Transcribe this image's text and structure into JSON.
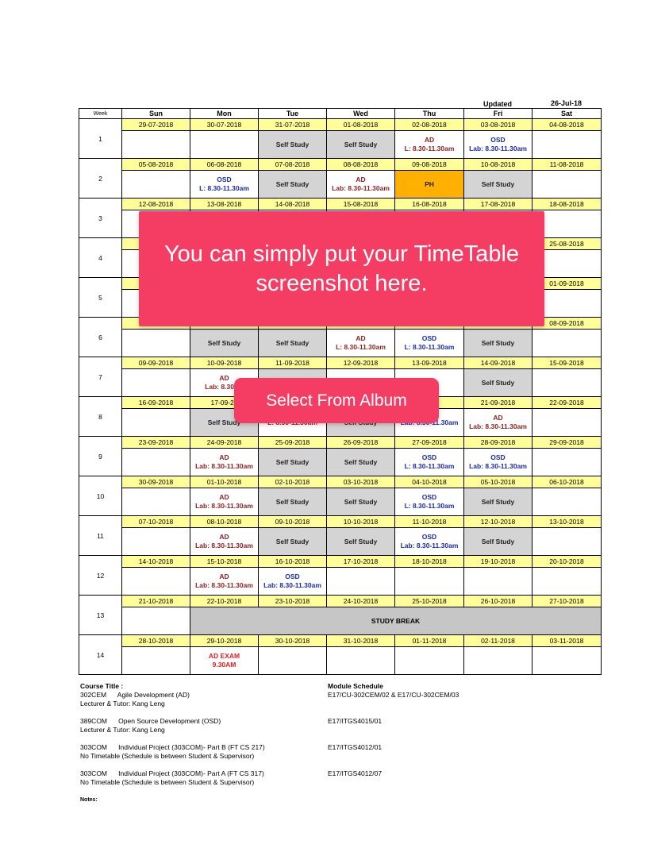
{
  "header": {
    "updated_label": "Updated",
    "updated_date": "26-Jul-18"
  },
  "days": [
    "Week",
    "Sun",
    "Mon",
    "Tue",
    "Wed",
    "Thu",
    "Fri",
    "Sat"
  ],
  "weeks": [
    {
      "week": "1",
      "dates": [
        "29-07-2018",
        "30-07-2018",
        "31-07-2018",
        "01-08-2018",
        "02-08-2018",
        "03-08-2018",
        "04-08-2018"
      ],
      "cells": [
        null,
        null,
        {
          "type": "ss",
          "lines": [
            "Self Study"
          ]
        },
        {
          "type": "ss",
          "lines": [
            "Self Study"
          ]
        },
        {
          "type": "ad",
          "lines": [
            "AD",
            "L: 8.30-11.30am"
          ]
        },
        {
          "type": "osd",
          "lines": [
            "OSD",
            "Lab: 8.30-11.30am"
          ]
        },
        null
      ]
    },
    {
      "week": "2",
      "dates": [
        "05-08-2018",
        "06-08-2018",
        "07-08-2018",
        "08-08-2018",
        "09-08-2018",
        "10-08-2018",
        "11-08-2018"
      ],
      "cells": [
        null,
        {
          "type": "osd",
          "lines": [
            "OSD",
            "L: 8.30-11.30am"
          ]
        },
        {
          "type": "ss",
          "lines": [
            "Self Study"
          ]
        },
        {
          "type": "ad",
          "lines": [
            "AD",
            "Lab: 8.30-11.30am"
          ]
        },
        {
          "type": "ph",
          "lines": [
            "PH"
          ]
        },
        {
          "type": "ss",
          "lines": [
            "Self Study"
          ]
        },
        null
      ]
    },
    {
      "week": "3",
      "dates": [
        "12-08-2018",
        "13-08-2018",
        "14-08-2018",
        "15-08-2018",
        "16-08-2018",
        "17-08-2018",
        "18-08-2018"
      ],
      "cells": [
        null,
        null,
        null,
        null,
        null,
        null,
        null
      ]
    },
    {
      "week": "4",
      "dates": [
        "",
        "",
        "",
        "",
        "",
        "",
        "25-08-2018"
      ],
      "cells": [
        null,
        null,
        null,
        null,
        null,
        null,
        null
      ]
    },
    {
      "week": "5",
      "dates": [
        "",
        "",
        "",
        "",
        "",
        "",
        "01-09-2018"
      ],
      "cells": [
        null,
        null,
        null,
        null,
        null,
        null,
        null
      ]
    },
    {
      "week": "6",
      "dates": [
        "",
        "",
        "",
        "",
        "",
        "",
        "08-09-2018"
      ],
      "cells": [
        null,
        {
          "type": "ss",
          "lines": [
            "Self Study"
          ]
        },
        {
          "type": "ss",
          "lines": [
            "Self Study"
          ]
        },
        {
          "type": "ad",
          "lines": [
            "AD",
            "L: 8.30-11.30am"
          ]
        },
        {
          "type": "osd",
          "lines": [
            "OSD",
            "L: 8.30-11.30am"
          ]
        },
        {
          "type": "ss",
          "lines": [
            "Self Study"
          ]
        },
        null
      ]
    },
    {
      "week": "7",
      "dates": [
        "09-09-2018",
        "10-09-2018",
        "11-09-2018",
        "12-09-2018",
        "13-09-2018",
        "14-09-2018",
        "15-09-2018"
      ],
      "cells": [
        null,
        {
          "type": "ad",
          "lines": [
            "AD",
            "Lab: 8.30-11"
          ]
        },
        {
          "type": "ss",
          "lines": [
            ""
          ]
        },
        null,
        {
          "type": "osd",
          "lines": [
            "",
            ".30am"
          ]
        },
        {
          "type": "ss",
          "lines": [
            "Self Study"
          ]
        },
        null
      ]
    },
    {
      "week": "8",
      "dates": [
        "16-09-2018",
        "17-09-20",
        "",
        "",
        "18",
        "21-09-2018",
        "22-09-2018"
      ],
      "cells": [
        null,
        {
          "type": "ss",
          "lines": [
            "Self Study"
          ]
        },
        {
          "type": "ad",
          "lines": [
            "",
            "L: 8.30-11.30am"
          ]
        },
        {
          "type": "ss",
          "lines": [
            "Self Study"
          ]
        },
        {
          "type": "osd",
          "lines": [
            "",
            "Lab: 8.30-11.30am"
          ]
        },
        {
          "type": "ad",
          "lines": [
            "AD",
            "Lab: 8.30-11.30am"
          ]
        },
        null
      ]
    },
    {
      "week": "9",
      "dates": [
        "23-09-2018",
        "24-09-2018",
        "25-09-2018",
        "26-09-2018",
        "27-09-2018",
        "28-09-2018",
        "29-09-2018"
      ],
      "cells": [
        null,
        {
          "type": "ad",
          "lines": [
            "AD",
            "Lab: 8.30-11.30am"
          ]
        },
        {
          "type": "ss",
          "lines": [
            "Self Study"
          ]
        },
        {
          "type": "ss",
          "lines": [
            "Self Study"
          ]
        },
        {
          "type": "osd",
          "lines": [
            "OSD",
            "L: 8.30-11.30am"
          ]
        },
        {
          "type": "osd",
          "lines": [
            "OSD",
            "Lab: 8.30-11.30am"
          ]
        },
        null
      ]
    },
    {
      "week": "10",
      "dates": [
        "30-09-2018",
        "01-10-2018",
        "02-10-2018",
        "03-10-2018",
        "04-10-2018",
        "05-10-2018",
        "06-10-2018"
      ],
      "cells": [
        null,
        {
          "type": "ad",
          "lines": [
            "AD",
            "Lab: 8.30-11.30am"
          ]
        },
        {
          "type": "ss",
          "lines": [
            "Self Study"
          ]
        },
        {
          "type": "ss",
          "lines": [
            "Self Study"
          ]
        },
        {
          "type": "osd",
          "lines": [
            "OSD",
            "L: 8.30-11.30am"
          ]
        },
        {
          "type": "ss",
          "lines": [
            "Self Study"
          ]
        },
        null
      ]
    },
    {
      "week": "11",
      "dates": [
        "07-10-2018",
        "08-10-2018",
        "09-10-2018",
        "10-10-2018",
        "11-10-2018",
        "12-10-2018",
        "13-10-2018"
      ],
      "cells": [
        null,
        {
          "type": "ad",
          "lines": [
            "AD",
            "Lab: 8.30-11.30am"
          ]
        },
        {
          "type": "ss",
          "lines": [
            "Self Study"
          ]
        },
        {
          "type": "ss",
          "lines": [
            "Self Study"
          ]
        },
        {
          "type": "osd",
          "lines": [
            "OSD",
            "Lab: 8.30-11.30am"
          ]
        },
        {
          "type": "ss",
          "lines": [
            "Self Study"
          ]
        },
        null
      ]
    },
    {
      "week": "12",
      "dates": [
        "14-10-2018",
        "15-10-2018",
        "16-10-2018",
        "17-10-2018",
        "18-10-2018",
        "19-10-2018",
        "20-10-2018"
      ],
      "cells": [
        null,
        {
          "type": "ad",
          "lines": [
            "AD",
            "Lab: 8.30-11.30am"
          ]
        },
        {
          "type": "osd",
          "lines": [
            "OSD",
            "Lab: 8.30-11.30am"
          ]
        },
        null,
        null,
        null,
        null
      ]
    },
    {
      "week": "13",
      "dates": [
        "21-10-2018",
        "22-10-2018",
        "23-10-2018",
        "24-10-2018",
        "25-10-2018",
        "26-10-2018",
        "27-10-2018"
      ],
      "study_break": "STUDY BREAK"
    },
    {
      "week": "14",
      "dates": [
        "28-10-2018",
        "29-10-2018",
        "30-10-2018",
        "31-10-2018",
        "01-11-2018",
        "02-11-2018",
        "03-11-2018"
      ],
      "cells": [
        null,
        {
          "type": "exam",
          "lines": [
            "AD EXAM",
            "9.30AM"
          ]
        },
        null,
        null,
        null,
        null,
        null
      ]
    }
  ],
  "footer": {
    "course_title_label": "Course Title :",
    "module_schedule_label": "Module Schedule",
    "courses": [
      {
        "line1": "302CEM      Agile Development (AD)",
        "line2": "Lecturer & Tutor: Kang Leng",
        "schedule": "E17/CU-302CEM/02 & E17/CU-302CEM/03"
      },
      {
        "line1": "389COM      Open Source Development (OSD)",
        "line2": "Lecturer & Tutor: Kang Leng",
        "schedule": "E17/ITGS4015/01"
      },
      {
        "line1": "303COM      Individual Project (303COM)- Part B (FT CS 217)",
        "line2": "No Timetable (Schedule is between Student & Supervisor)",
        "schedule": "E17/ITGS4012/01"
      },
      {
        "line1": "303COM      Individual Project (303COM)- Part A (FT CS 317)",
        "line2": "No Timetable (Schedule is between Student & Supervisor)",
        "schedule": "E17/ITGS4012/07"
      }
    ],
    "notes_label": "Notes:"
  },
  "overlay": {
    "message": "You can simply put your TimeTable screenshot here."
  },
  "album_button": {
    "label": "Select From Album"
  },
  "colors": {
    "accent": "#f53d64",
    "date_row": "#fffe99",
    "self_study": "#d4d4d4",
    "public_holiday": "#ffb000",
    "ad_text": "#8c1e1e",
    "osd_text": "#1a2aa8",
    "exam_text": "#e21d1d"
  }
}
